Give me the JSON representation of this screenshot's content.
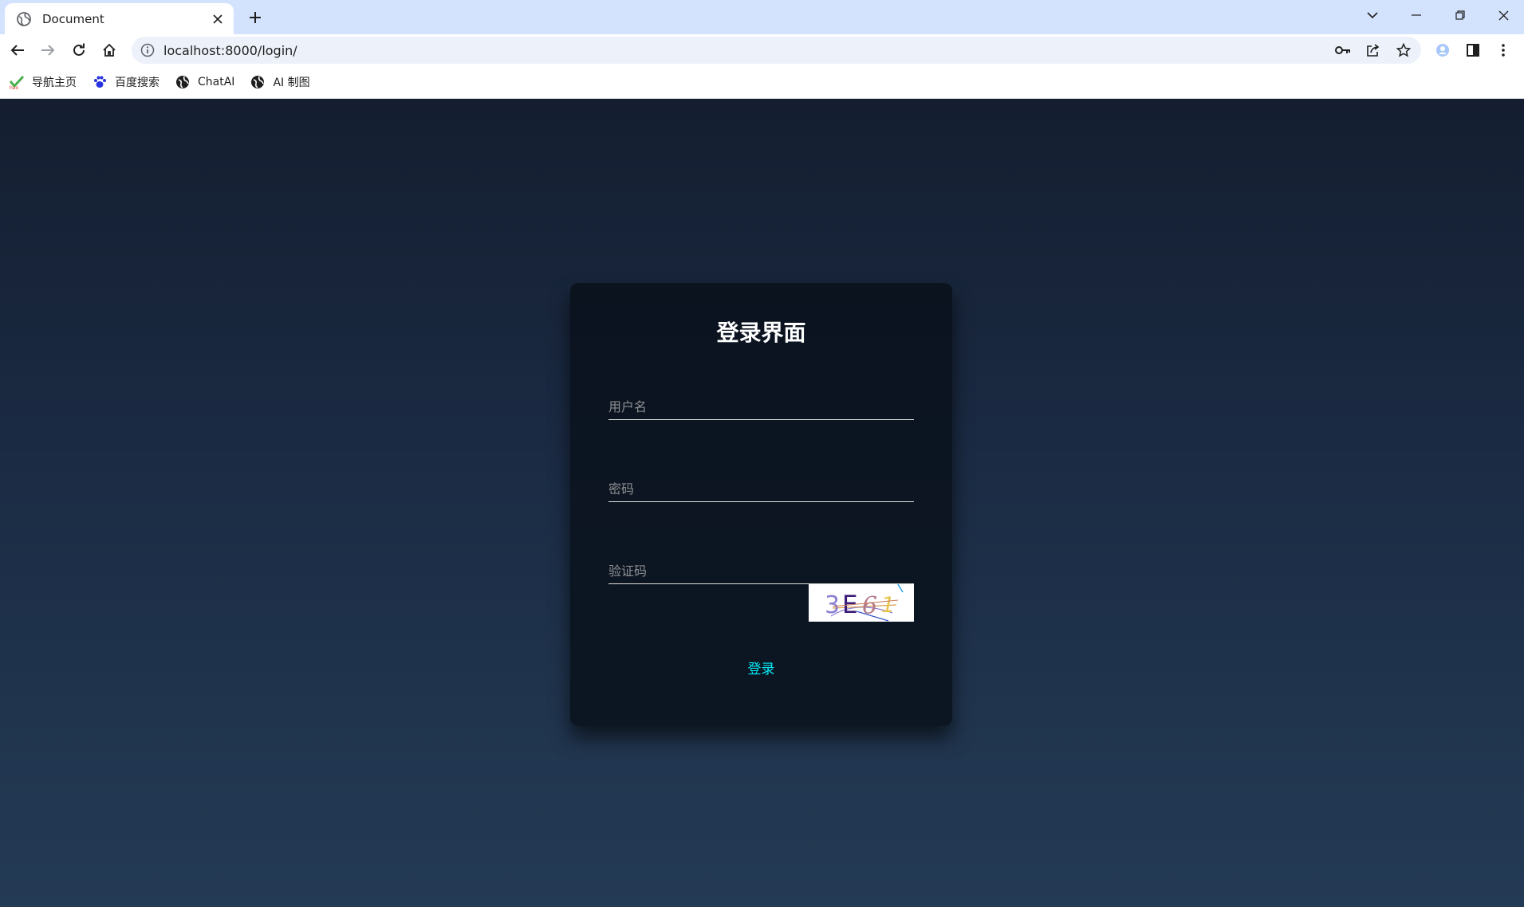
{
  "browser": {
    "tab": {
      "title": "Document"
    },
    "address_bar": {
      "url": "localhost:8000/login/"
    },
    "bookmarks": [
      {
        "label": "导航主页",
        "icon": "hao-icon"
      },
      {
        "label": "百度搜索",
        "icon": "baidu-paw-icon"
      },
      {
        "label": "ChatAI",
        "icon": "globe-icon"
      },
      {
        "label": "AI 制图",
        "icon": "globe-icon"
      }
    ]
  },
  "login": {
    "title": "登录界面",
    "username_placeholder": "用户名",
    "password_placeholder": "密码",
    "captcha_placeholder": "验证码",
    "captcha_text": "3E61",
    "submit_label": "登录"
  },
  "colors": {
    "accent": "#03e9f4",
    "page_gradient_top": "#141e30",
    "page_gradient_bottom": "#243b55",
    "tabstrip": "#d3e3fd"
  }
}
